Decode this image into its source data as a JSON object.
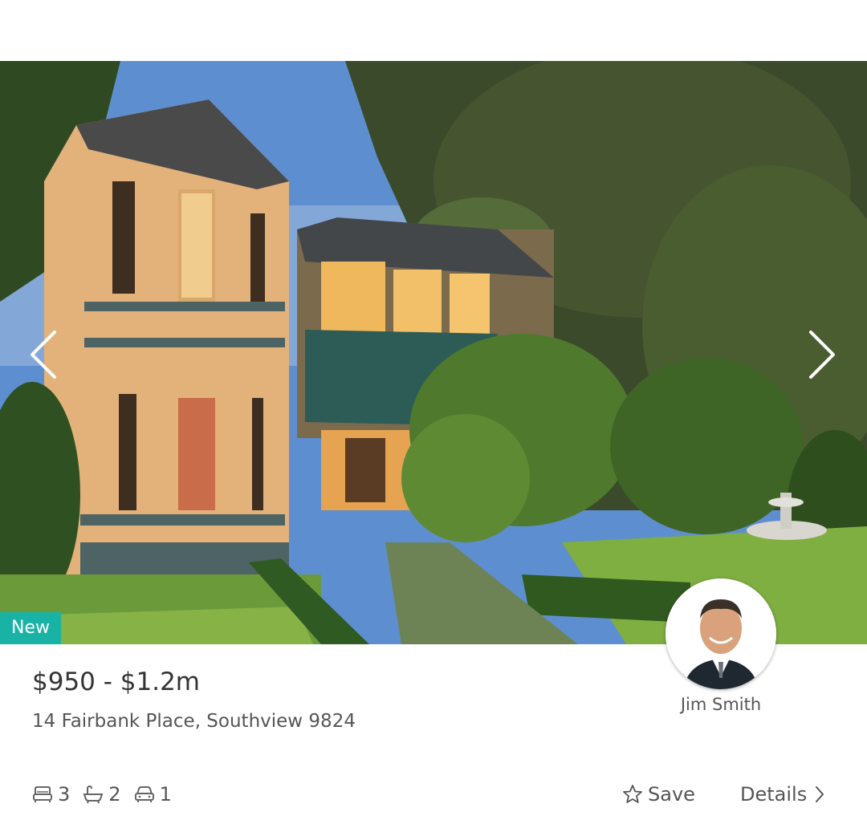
{
  "listing": {
    "badge": "New",
    "price": "$950 - $1.2m",
    "address": "14 Fairbank Place, Southview 9824",
    "features": {
      "bedrooms": "3",
      "bathrooms": "2",
      "car_spaces": "1"
    },
    "save_label": "Save",
    "details_label": "Details"
  },
  "agent": {
    "name": "Jim Smith"
  },
  "icons": {
    "prev": "chevron-left-icon",
    "next": "chevron-right-icon",
    "bed": "bed-icon",
    "bath": "bath-icon",
    "car": "car-icon",
    "save": "star-icon",
    "details": "chevron-right-icon"
  },
  "colors": {
    "badge": "#19b3a6"
  }
}
